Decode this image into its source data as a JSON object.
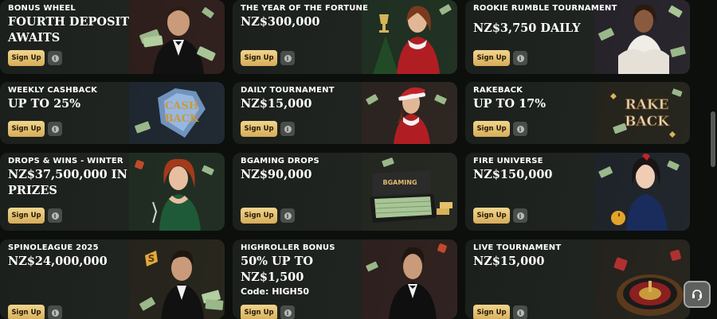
{
  "colors": {
    "background": "#0c0f0c",
    "card": "#1e221e",
    "button_gold": "#e3c070",
    "info_button": "#4a4e4a"
  },
  "promos": [
    {
      "subtitle": "BONUS WHEEL",
      "title": "FOURTH DEPOSIT AWAITS",
      "button": "Sign Up",
      "art": "man-with-cash-illustration"
    },
    {
      "subtitle": "THE YEAR OF THE FORTUNE",
      "title": "NZ$300,000",
      "button": "Sign Up",
      "art": "woman-with-trophy-illustration"
    },
    {
      "subtitle": "ROOKIE RUMBLE TOURNAMENT",
      "title": "NZ$3,750 DAILY",
      "button": "Sign Up",
      "art": "woman-with-cash-illustration"
    },
    {
      "subtitle": "WEEKLY CASHBACK",
      "title": "UP TO 25%",
      "button": "Sign Up",
      "art": "cashback-diamond-illustration",
      "art_text": [
        "CASH",
        "BACK"
      ]
    },
    {
      "subtitle": "DAILY TOURNAMENT",
      "title": "NZ$15,000",
      "button": "Sign Up",
      "art": "santa-woman-illustration"
    },
    {
      "subtitle": "RAKEBACK",
      "title": "UP TO 17%",
      "button": "Sign Up",
      "art": "rakeback-illustration",
      "art_text": [
        "RAKE",
        "BACK"
      ]
    },
    {
      "subtitle": "DROPS & WINS - WINTER",
      "title": "NZ$37,500,000 IN PRIZES",
      "button": "Sign Up",
      "art": "redhead-woman-illustration"
    },
    {
      "subtitle": "BGAMING DROPS",
      "title": "NZ$90,000",
      "button": "Sign Up",
      "art": "cash-briefcase-illustration",
      "art_text": [
        "BGAMING"
      ]
    },
    {
      "subtitle": "FIRE UNIVERSE",
      "title": "NZ$150,000",
      "button": "Sign Up",
      "art": "woman-with-apple-illustration"
    },
    {
      "subtitle": "SPINOLEAGUE 2025",
      "title": "NZ$24,000,000",
      "button": "Sign Up",
      "art": "smiling-man-illustration"
    },
    {
      "subtitle": "HIGHROLLER BONUS",
      "title": "50% UP TO NZ$1,500",
      "code": "Code: HIGH50",
      "button": "Sign Up",
      "art": "man-in-tuxedo-illustration"
    },
    {
      "subtitle": "LIVE TOURNAMENT",
      "title": "NZ$15,000",
      "button": "Sign Up",
      "art": "roulette-wheel-illustration"
    }
  ],
  "support_icon": "headset-icon"
}
